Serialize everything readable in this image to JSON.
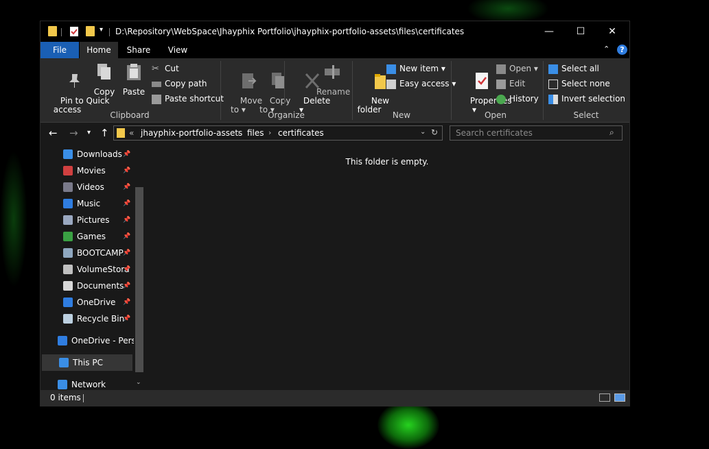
{
  "window": {
    "title": "D:\\Repository\\WebSpace\\Jhayphix Portfolio\\jhayphix-portfolio-assets\\files\\certificates",
    "minimize": "—",
    "maximize": "☐",
    "close": "✕"
  },
  "ribbon_tabs": [
    "File",
    "Home",
    "Share",
    "View"
  ],
  "ribbon": {
    "clipboard": {
      "label": "Clipboard",
      "pin": "Pin to Quick\naccess",
      "copy": "Copy",
      "paste": "Paste",
      "cut": "Cut",
      "copy_path": "Copy path",
      "paste_shortcut": "Paste shortcut"
    },
    "organize": {
      "label": "Organize",
      "move_to": "Move\nto ▾",
      "copy_to": "Copy\nto ▾",
      "delete": "Delete\n▾",
      "rename": "Rename"
    },
    "new": {
      "label": "New",
      "new_folder": "New\nfolder",
      "new_item": "New item ▾",
      "easy_access": "Easy access ▾"
    },
    "open": {
      "label": "Open",
      "properties": "Properties\n▾",
      "open": "Open ▾",
      "edit": "Edit",
      "history": "History"
    },
    "select": {
      "label": "Select",
      "select_all": "Select all",
      "select_none": "Select none",
      "invert": "Invert selection"
    }
  },
  "address": {
    "overflow": "«",
    "crumbs": [
      "jhayphix-portfolio-assets",
      "files",
      "certificates"
    ],
    "separator": "›",
    "search_placeholder": "Search certificates"
  },
  "nav_items": [
    {
      "label": "Downloads",
      "icon": "download-icon",
      "color": "#3a8ee6",
      "pinned": true
    },
    {
      "label": "Movies",
      "icon": "movies-folder-icon",
      "color": "#d04040",
      "pinned": true
    },
    {
      "label": "Videos",
      "icon": "videos-folder-icon",
      "color": "#7a7a8a",
      "pinned": true
    },
    {
      "label": "Music",
      "icon": "music-icon",
      "color": "#2f7de0",
      "pinned": true
    },
    {
      "label": "Pictures",
      "icon": "pictures-icon",
      "color": "#9aa8c0",
      "pinned": true
    },
    {
      "label": "Games",
      "icon": "games-folder-icon",
      "color": "#3aa043",
      "pinned": true
    },
    {
      "label": "BOOTCAMP",
      "icon": "drive-icon",
      "color": "#8fa8c0",
      "pinned": true
    },
    {
      "label": "VolumeStora",
      "icon": "drive-icon",
      "color": "#c0c0c0",
      "pinned": true
    },
    {
      "label": "Documents",
      "icon": "documents-icon",
      "color": "#d8d8d8",
      "pinned": true
    },
    {
      "label": "OneDrive",
      "icon": "onedrive-icon",
      "color": "#2f7de0",
      "pinned": true
    },
    {
      "label": "Recycle Bin",
      "icon": "recycle-bin-icon",
      "color": "#bcd0e0",
      "pinned": true
    }
  ],
  "nav_root": [
    {
      "label": "OneDrive - Perso",
      "icon": "onedrive-icon",
      "color": "#2f7de0"
    },
    {
      "label": "This PC",
      "icon": "this-pc-icon",
      "color": "#3a8ee6",
      "selected": true
    },
    {
      "label": "Network",
      "icon": "network-icon",
      "color": "#3a8ee6"
    }
  ],
  "content": {
    "empty_message": "This folder is empty."
  },
  "status": {
    "items": "0 items"
  },
  "colors": {
    "file_tab": "#1a5fb4",
    "folder": "#f2c84b",
    "accent_blue": "#2f7de0"
  }
}
